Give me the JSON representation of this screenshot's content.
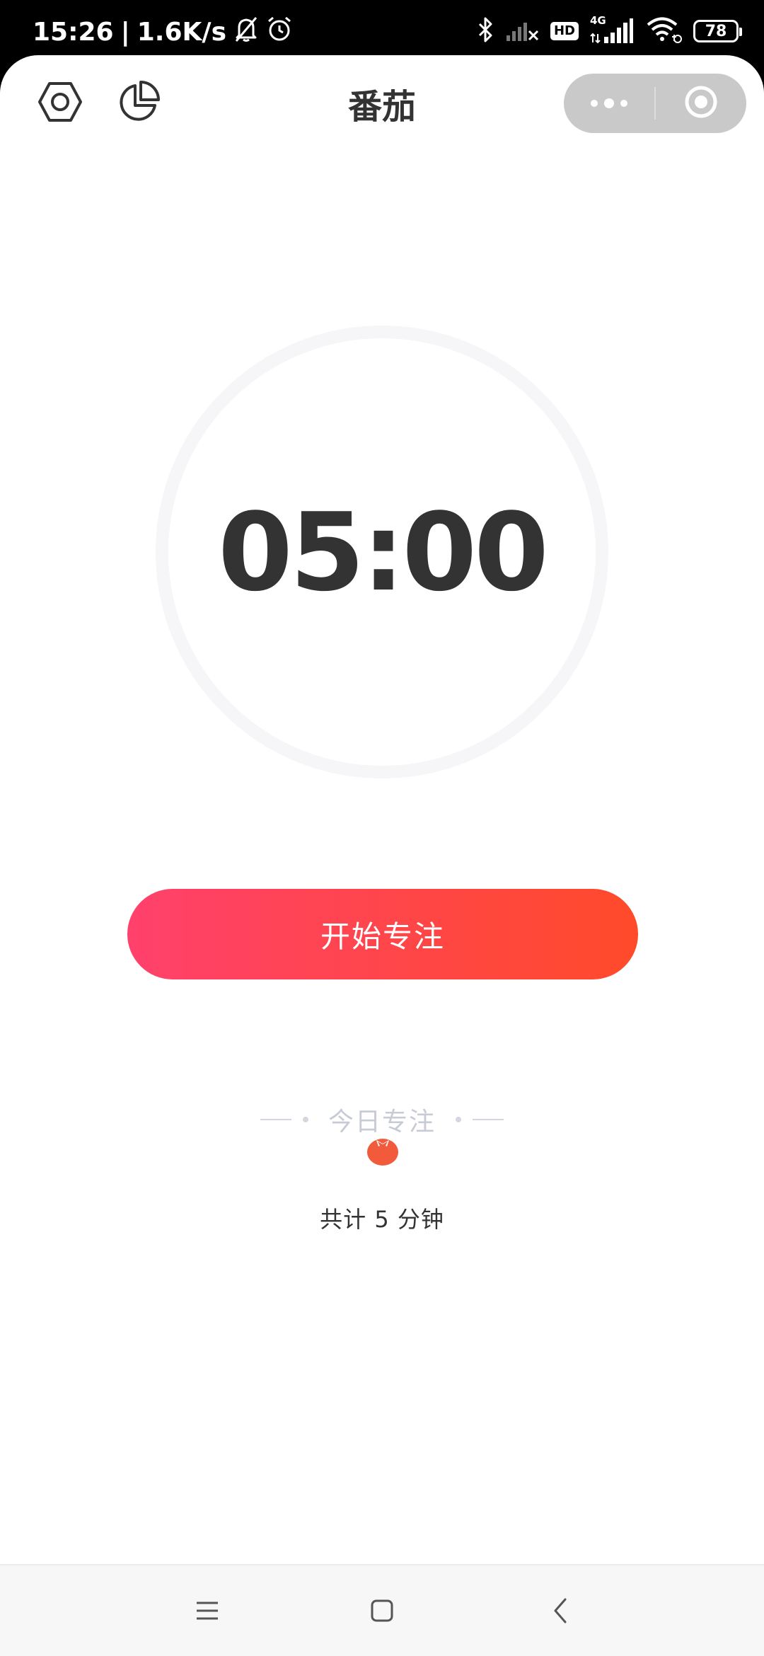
{
  "status_bar": {
    "time": "15:26",
    "separator": "|",
    "network_speed": "1.6K/s",
    "hd_badge": "HD",
    "network_type": "4G",
    "battery_level": "78",
    "icons": [
      "bell-off-icon",
      "alarm-icon",
      "bluetooth-icon",
      "signal-icon",
      "wifi-icon",
      "battery-icon"
    ]
  },
  "nav": {
    "title": "番茄",
    "left_icons": [
      "settings-hexagon-icon",
      "stats-pie-icon"
    ],
    "capsule_icons": [
      "more-dots-icon",
      "close-target-icon"
    ]
  },
  "timer": {
    "display": "05:00"
  },
  "actions": {
    "start_label": "开始专注"
  },
  "today": {
    "label": "今日专注",
    "tomato_icon": "tomato-icon",
    "total": "共计 5 分钟"
  },
  "colors": {
    "gradient_start": "#ff416c",
    "gradient_end": "#ff4a2a",
    "tomato": "#f25a3c",
    "text_dark": "#333333",
    "muted": "#c8cbd6"
  },
  "system_nav": {
    "icons": [
      "menu-icon",
      "home-icon",
      "back-icon"
    ]
  }
}
